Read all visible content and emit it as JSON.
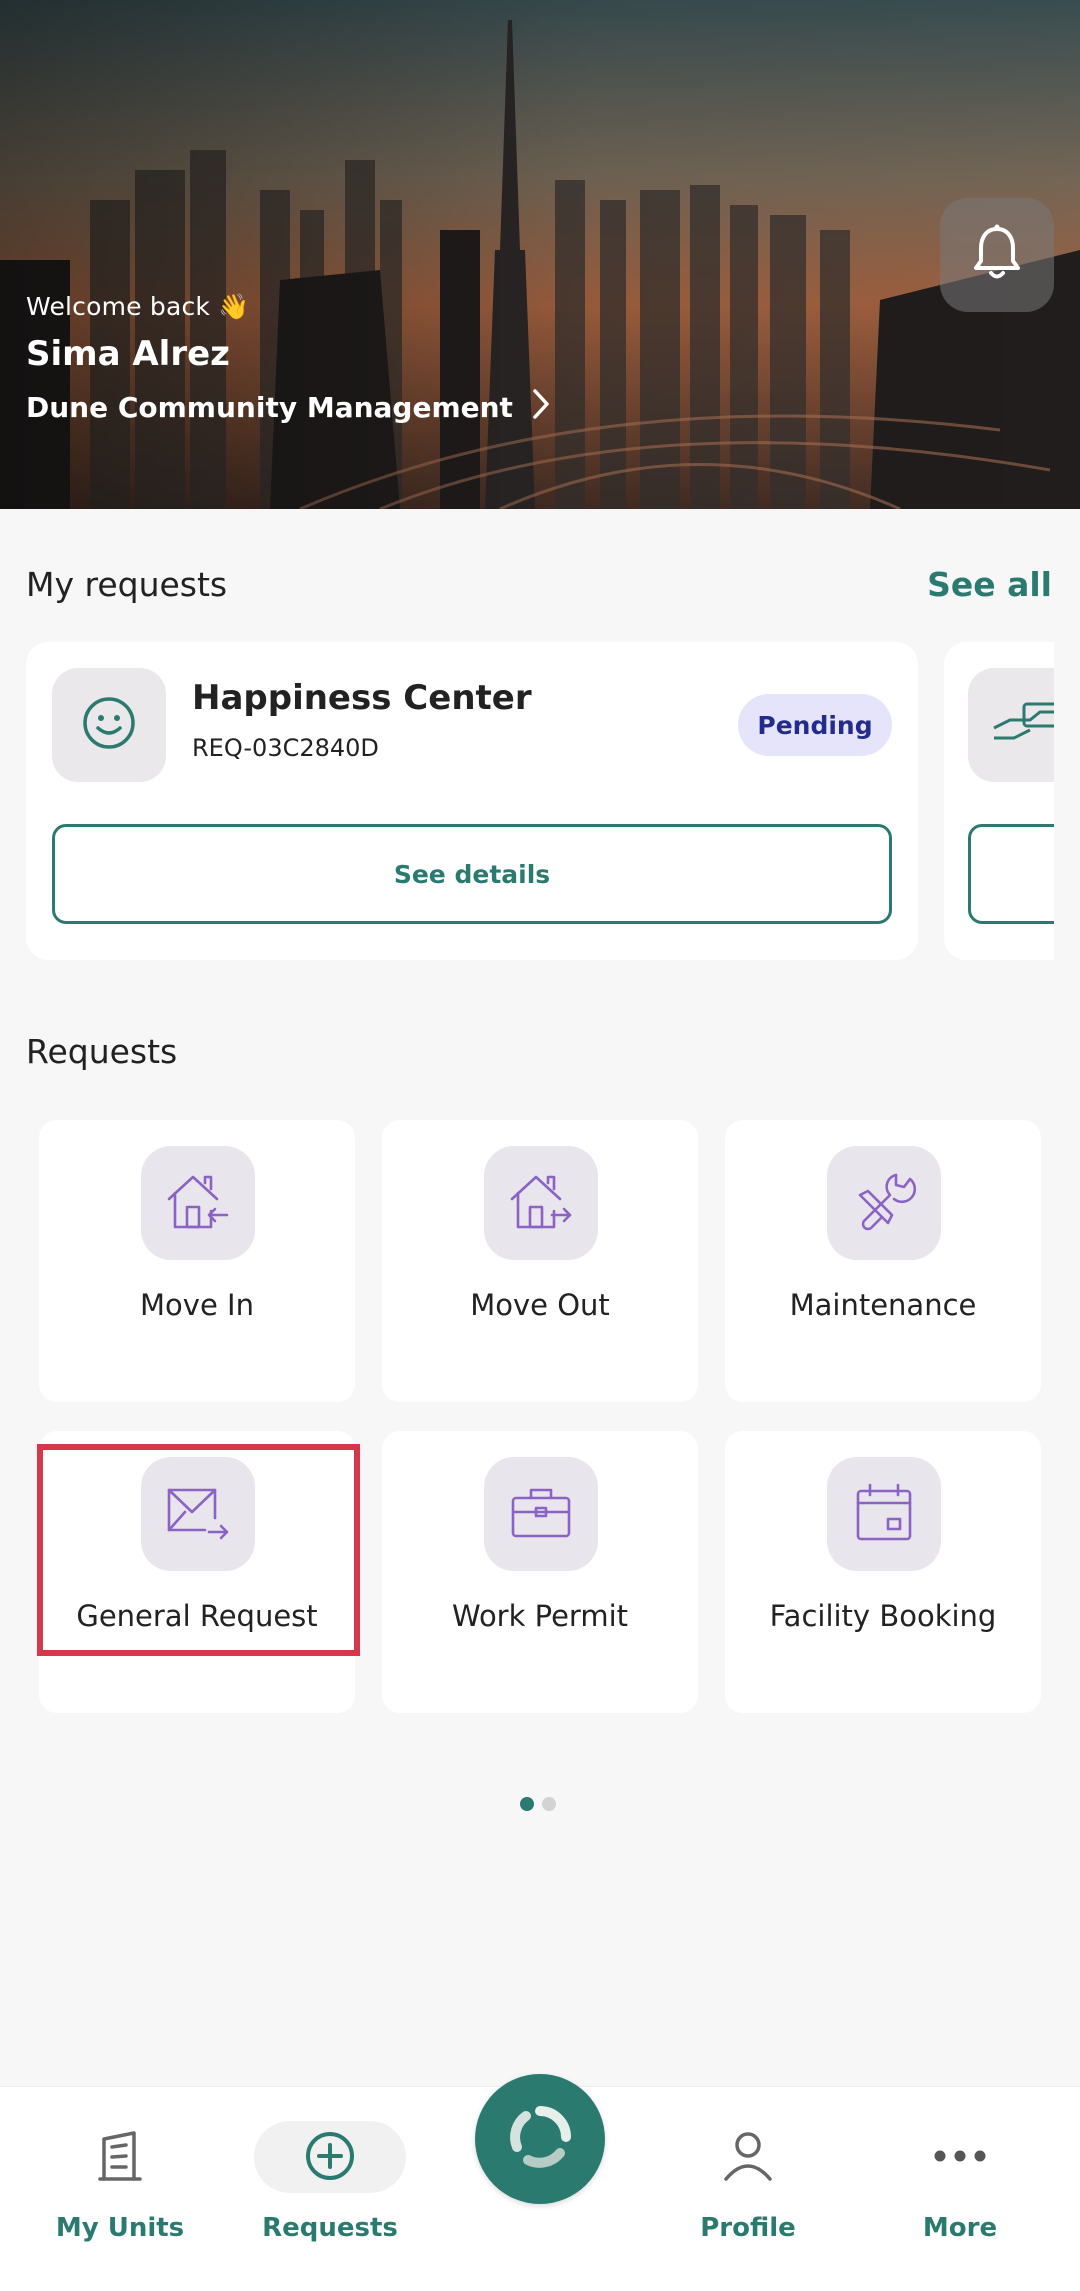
{
  "hero": {
    "welcome": "Welcome back 👋",
    "user_name": "Sima Alrez",
    "community": "Dune Community Management"
  },
  "my_requests": {
    "title": "My requests",
    "see_all": "See all",
    "cards": [
      {
        "icon": "smiley-icon",
        "title": "Happiness Center",
        "id": "REQ-03C2840D",
        "status": "Pending",
        "button": "See details"
      }
    ]
  },
  "requests": {
    "title": "Requests",
    "items": [
      {
        "label": "Move In",
        "icon": "move-in-icon"
      },
      {
        "label": "Move Out",
        "icon": "move-out-icon"
      },
      {
        "label": "Maintenance",
        "icon": "maintenance-icon"
      },
      {
        "label": "General Request",
        "icon": "envelope-icon"
      },
      {
        "label": "Work Permit",
        "icon": "briefcase-icon"
      },
      {
        "label": "Facility Booking",
        "icon": "calendar-icon"
      }
    ],
    "page_count": 2,
    "active_page": 1
  },
  "bottom_nav": {
    "items": [
      {
        "label": "My Units",
        "icon": "building-icon"
      },
      {
        "label": "Requests",
        "icon": "plus-circle-icon"
      },
      {
        "label": "Profile",
        "icon": "person-icon"
      },
      {
        "label": "More",
        "icon": "more-dots-icon"
      }
    ]
  },
  "colors": {
    "accent": "#2b7a70",
    "icon_purple": "#8a63c4",
    "pending_bg": "#e5e4fb",
    "pending_text": "#232c8c",
    "highlight": "#d7374b"
  }
}
